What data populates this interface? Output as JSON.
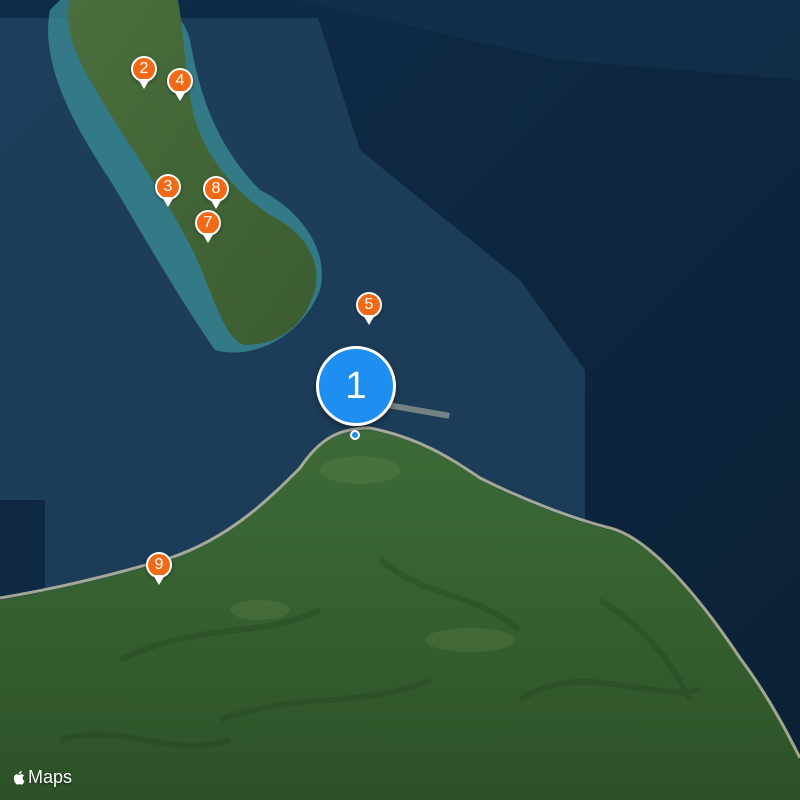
{
  "map": {
    "type": "satellite",
    "brand": {
      "icon": "apple-logo-icon",
      "label": "Maps"
    },
    "colors": {
      "water": "#0e2a45",
      "shallow_water": "#3b8c95",
      "land": "#3f6a35",
      "pin_primary": "#1f8ef1",
      "pin_secondary": "#f26a16"
    }
  },
  "pins": [
    {
      "label": "1",
      "style": "primary"
    },
    {
      "label": "2",
      "style": "secondary"
    },
    {
      "label": "3",
      "style": "secondary"
    },
    {
      "label": "4",
      "style": "secondary"
    },
    {
      "label": "5",
      "style": "secondary"
    },
    {
      "label": "7",
      "style": "secondary"
    },
    {
      "label": "8",
      "style": "secondary"
    },
    {
      "label": "9",
      "style": "secondary"
    }
  ]
}
